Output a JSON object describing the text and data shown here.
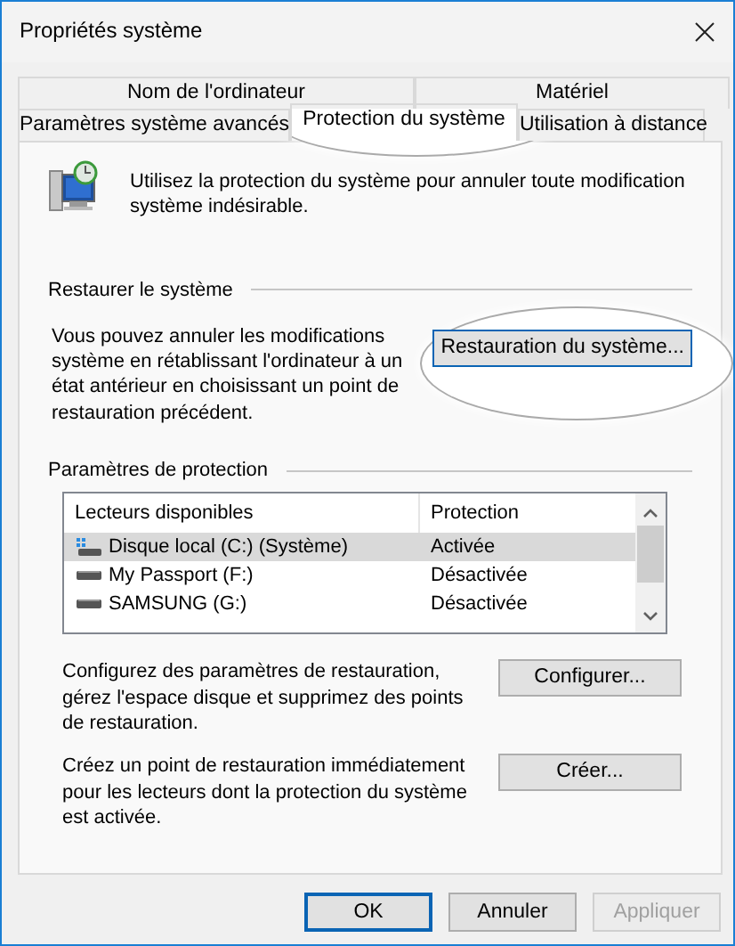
{
  "window": {
    "title": "Propriétés système"
  },
  "tab_rows": [
    [
      {
        "label": "Nom de l'ordinateur",
        "selected": false
      },
      {
        "label": "Matériel",
        "selected": false
      }
    ],
    [
      {
        "label": "Paramètres système avancés",
        "selected": false
      },
      {
        "label": "Protection du système",
        "selected": true
      },
      {
        "label": "Utilisation à distance",
        "selected": false
      }
    ]
  ],
  "intro": "Utilisez la protection du système pour annuler toute modification système indésirable.",
  "restore": {
    "title": "Restaurer le système",
    "text": "Vous pouvez annuler les modifications système en rétablissant l'ordinateur à un état antérieur en choisissant un point de restauration précédent.",
    "button": "Restauration du système..."
  },
  "protection": {
    "title": "Paramètres de protection",
    "columns": [
      "Lecteurs disponibles",
      "Protection"
    ],
    "rows": [
      {
        "drive": "Disque local (C:) (Système)",
        "protection": "Activée",
        "kind": "system",
        "selected": true
      },
      {
        "drive": "My Passport (F:)",
        "protection": "Désactivée",
        "kind": "external",
        "selected": false
      },
      {
        "drive": "SAMSUNG (G:)",
        "protection": "Désactivée",
        "kind": "external",
        "selected": false
      }
    ],
    "actions": [
      {
        "text": "Configurez des paramètres de restauration, gérez l'espace disque et supprimez des points de restauration.",
        "button": "Configurer..."
      },
      {
        "text": "Créez un point de restauration immédiatement pour les lecteurs dont la protection du système est activée.",
        "button": "Créer..."
      }
    ]
  },
  "buttons": [
    {
      "label": "OK",
      "default": true,
      "disabled": false
    },
    {
      "label": "Annuler",
      "default": false,
      "disabled": false
    },
    {
      "label": "Appliquer",
      "default": false,
      "disabled": true
    }
  ]
}
